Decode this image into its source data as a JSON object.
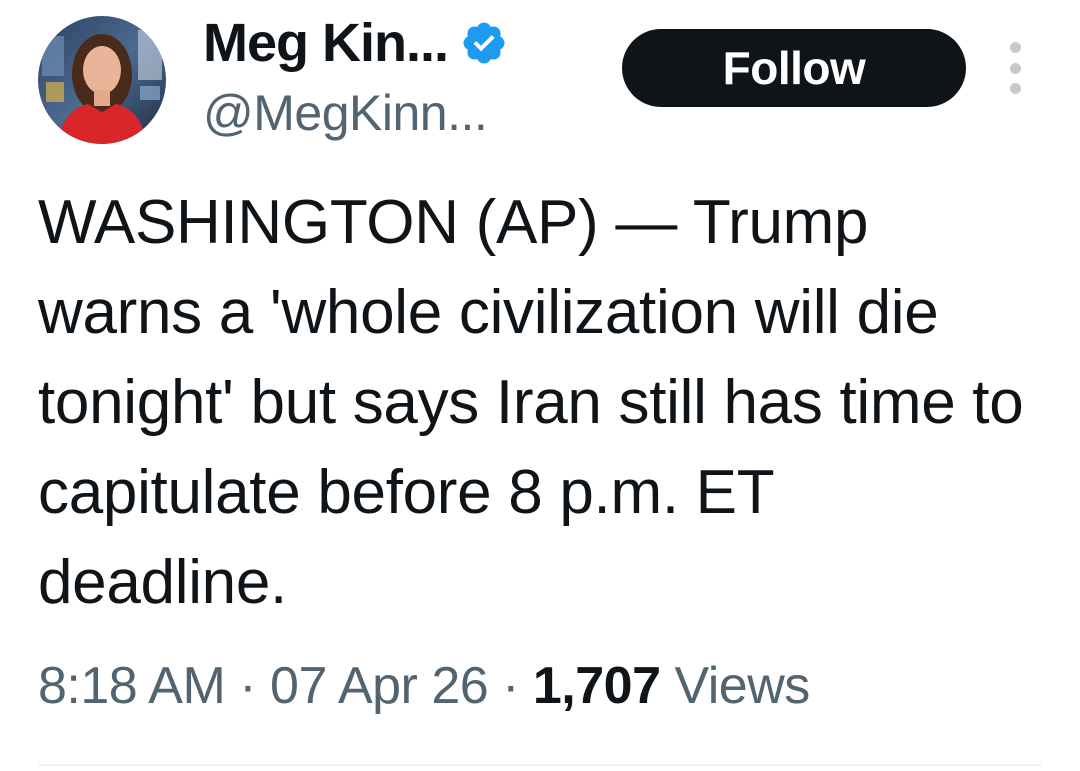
{
  "author": {
    "display_name": "Meg Kin...",
    "handle": "@MegKinn...",
    "verified": true
  },
  "actions": {
    "follow_label": "Follow",
    "more_icon": "more-dots-icon"
  },
  "tweet": {
    "text": "WASHINGTON (AP) — Trump warns a 'whole civilization will die tonight' but says Iran still has time to capitulate before 8 p.m. ET deadline."
  },
  "meta": {
    "time": "8:18 AM",
    "separator": "·",
    "date": "07 Apr 26",
    "views_count": "1,707",
    "views_label": "Views"
  },
  "colors": {
    "text": "#0f1419",
    "secondary": "#536471",
    "verified": "#1d9bf0",
    "button_bg": "#0f1419"
  }
}
